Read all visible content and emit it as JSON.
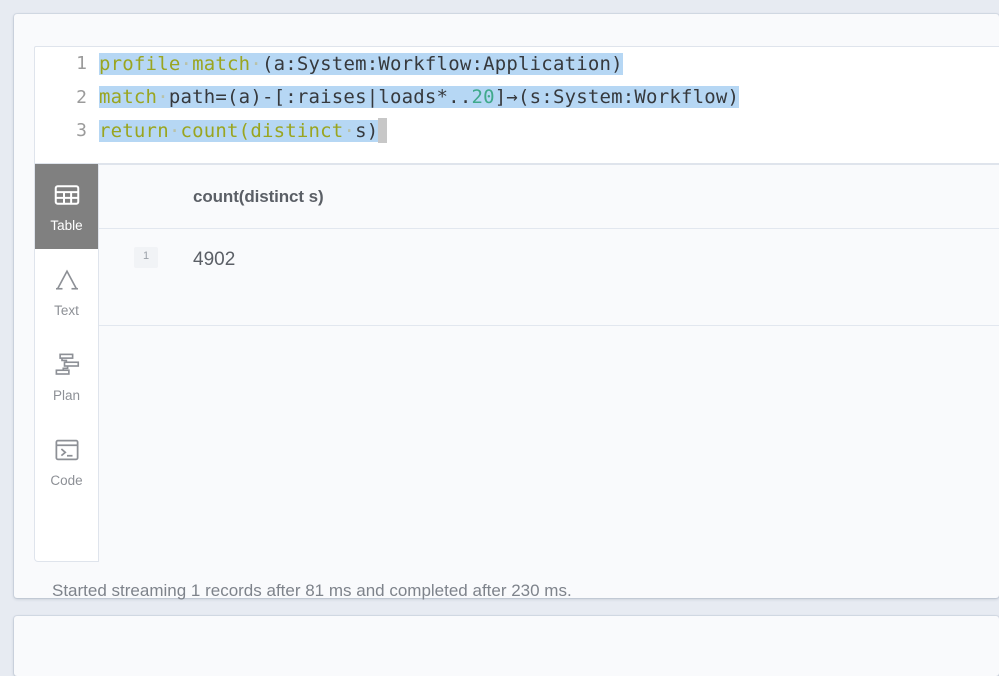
{
  "theme": {
    "page_bg": "#e7ebf2",
    "card_bg": "#f9fafc",
    "editor_bg": "#ffffff",
    "selection": "#b6d7f4",
    "keyword": "#9aa520",
    "number": "#3fa98b",
    "active_view_bg": "#808080",
    "text_muted": "#7e838b"
  },
  "editor": {
    "language": "cypher",
    "lines": [
      {
        "number": "1",
        "plain": "profile match (a:System:Workflow:Application)",
        "tokens": [
          {
            "text": "profile",
            "kind": "keyword"
          },
          {
            "text": "·",
            "kind": "dot"
          },
          {
            "text": "match",
            "kind": "keyword"
          },
          {
            "text": "·",
            "kind": "dot"
          },
          {
            "text": "(a:System:Workflow:Application)",
            "kind": "plain"
          }
        ]
      },
      {
        "number": "2",
        "plain": "match path=(a)-[:raises|loads*..20]→(s:System:Workflow)",
        "tokens": [
          {
            "text": "match",
            "kind": "keyword"
          },
          {
            "text": "·",
            "kind": "dot"
          },
          {
            "text": "path=(a)-[:raises|loads*..",
            "kind": "plain"
          },
          {
            "text": "20",
            "kind": "number"
          },
          {
            "text": "]→(s:System:Workflow)",
            "kind": "plain"
          }
        ]
      },
      {
        "number": "3",
        "plain": "return count(distinct s)",
        "tokens": [
          {
            "text": "return",
            "kind": "keyword"
          },
          {
            "text": "·",
            "kind": "dot"
          },
          {
            "text": "count(distinct",
            "kind": "keyword"
          },
          {
            "text": "·",
            "kind": "dot"
          },
          {
            "text": "s)",
            "kind": "plain"
          }
        ]
      }
    ]
  },
  "views": [
    {
      "id": "table",
      "label": "Table",
      "icon": "table-icon",
      "active": true
    },
    {
      "id": "text",
      "label": "Text",
      "icon": "text-a-icon",
      "active": false
    },
    {
      "id": "plan",
      "label": "Plan",
      "icon": "plan-tree-icon",
      "active": false
    },
    {
      "id": "code",
      "label": "Code",
      "icon": "terminal-icon",
      "active": false
    }
  ],
  "result_table": {
    "columns": [
      "count(distinct s)"
    ],
    "rows": [
      {
        "index": "1",
        "cells": [
          "4902"
        ]
      }
    ]
  },
  "status": {
    "message": "Started streaming 1 records after 81 ms and completed after 230 ms."
  }
}
